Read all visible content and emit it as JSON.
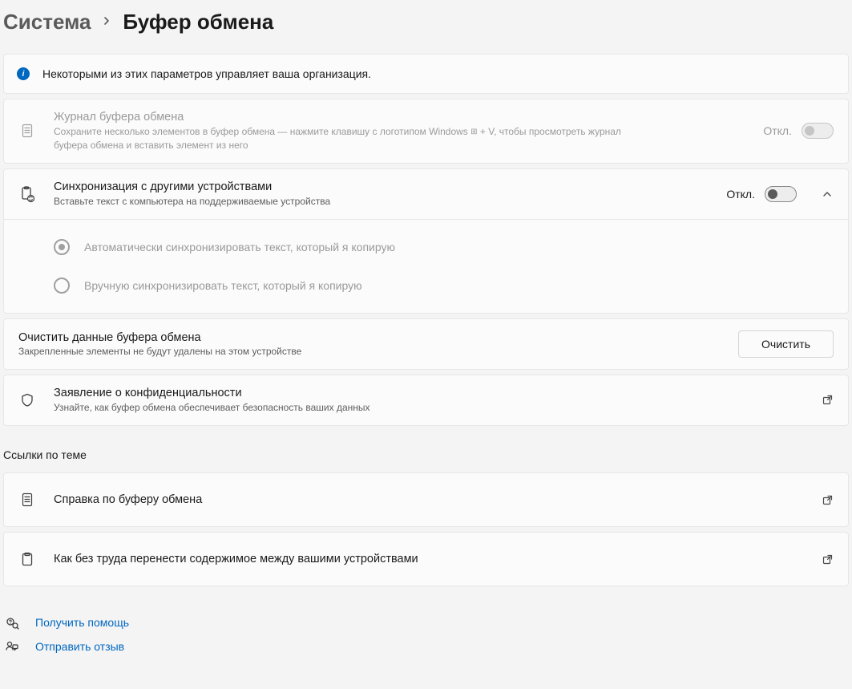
{
  "breadcrumb": {
    "parent": "Система",
    "current": "Буфер обмена"
  },
  "banner": {
    "text": "Некоторыми из этих параметров управляет ваша организация."
  },
  "history": {
    "title": "Журнал буфера обмена",
    "desc_pre": "Сохраните несколько элементов в буфер обмена — нажмите клавишу с логотипом Windows ",
    "desc_post": " + V, чтобы просмотреть журнал буфера обмена и вставить элемент из него",
    "toggle_label": "Откл."
  },
  "sync": {
    "title": "Синхронизация с другими устройствами",
    "desc": "Вставьте текст с компьютера на поддерживаемые устройства",
    "toggle_label": "Откл.",
    "options": [
      "Автоматически синхронизировать текст, который я копирую",
      "Вручную синхронизировать текст, который я копирую"
    ]
  },
  "clear": {
    "title": "Очистить данные буфера обмена",
    "desc": "Закрепленные элементы не будут удалены на этом устройстве",
    "button": "Очистить"
  },
  "privacy": {
    "title": "Заявление о конфиденциальности",
    "desc": "Узнайте, как буфер обмена обеспечивает безопасность ваших данных"
  },
  "related_heading": "Ссылки по теме",
  "related": [
    "Справка по буферу обмена",
    "Как без труда перенести содержимое между вашими устройствами"
  ],
  "footer": {
    "help": "Получить помощь",
    "feedback": "Отправить отзыв"
  }
}
